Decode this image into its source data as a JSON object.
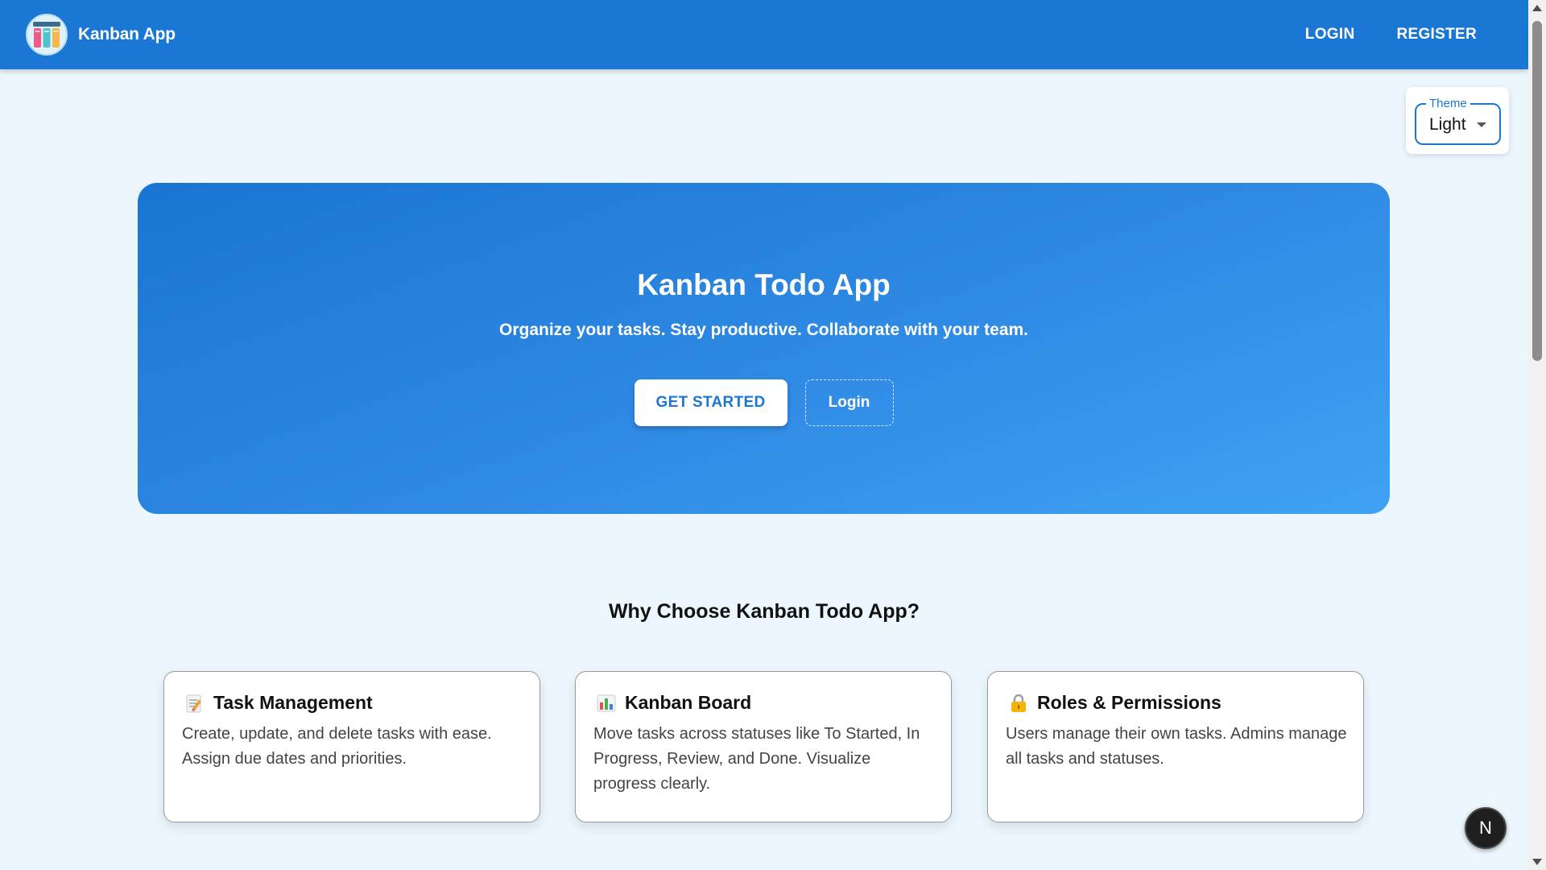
{
  "header": {
    "brand_title": "Kanban App",
    "logo_icon": "kanban-columns-icon",
    "nav": {
      "login_label": "LOGIN",
      "register_label": "REGISTER"
    }
  },
  "theme": {
    "legend": "Theme",
    "selected": "Light"
  },
  "hero": {
    "title": "Kanban Todo App",
    "subtitle": "Organize your tasks. Stay productive. Collaborate with your team.",
    "primary_label": "GET STARTED",
    "secondary_label": "Login"
  },
  "features": {
    "section_title": "Why Choose Kanban Todo App?",
    "items": [
      {
        "icon": "memo-icon",
        "title": "Task Management",
        "description": "Create, update, and delete tasks with ease. Assign due dates and priorities."
      },
      {
        "icon": "bar-chart-icon",
        "title": "Kanban Board",
        "description": "Move tasks across statuses like To Started, In Progress, Review, and Done. Visualize progress clearly."
      },
      {
        "icon": "lock-icon",
        "title": "Roles & Permissions",
        "description": "Users manage their own tasks. Admins manage all tasks and statuses."
      }
    ]
  },
  "fab": {
    "label": "N"
  },
  "colors": {
    "primary": "#1a77d4",
    "background": "#ebf6fd",
    "hero_gradient_start": "#1a74d2",
    "hero_gradient_end": "#40a2f4"
  }
}
